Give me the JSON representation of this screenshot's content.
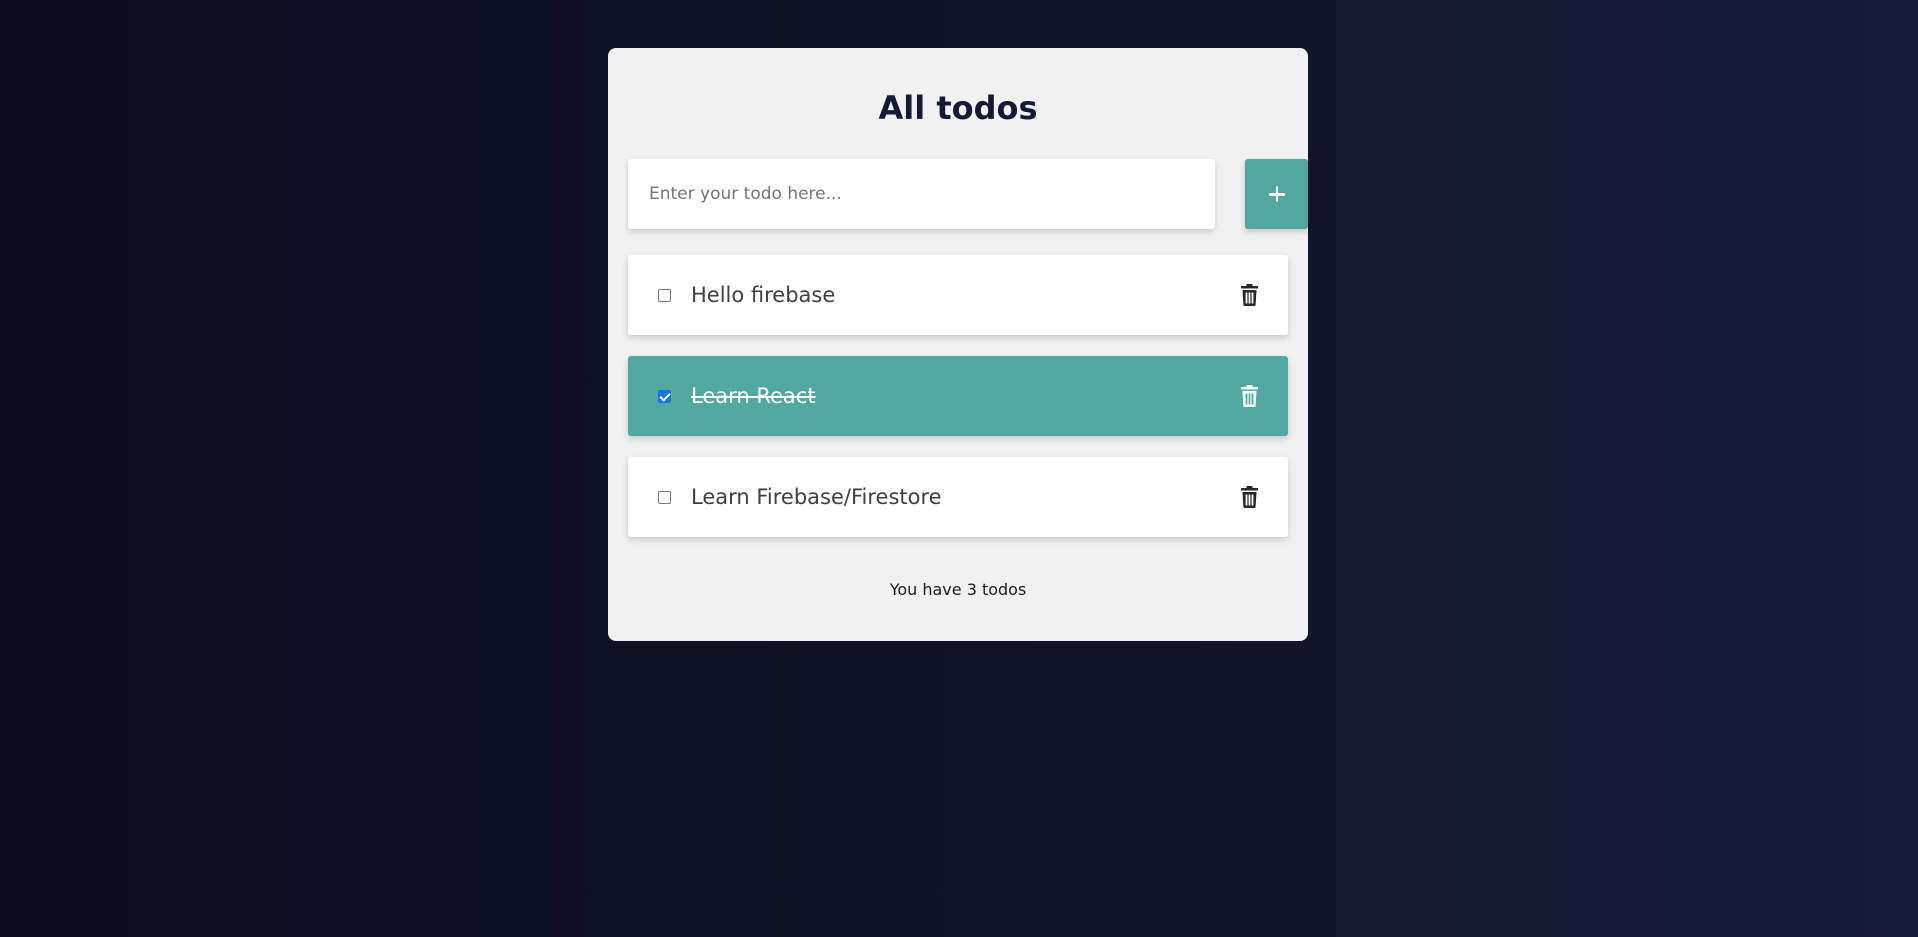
{
  "app": {
    "title": "All todos"
  },
  "input": {
    "placeholder": "Enter your todo here...",
    "value": ""
  },
  "add_button": {
    "icon": "plus-icon"
  },
  "todos": [
    {
      "text": "Hello firebase",
      "completed": false
    },
    {
      "text": "Learn React",
      "completed": true
    },
    {
      "text": "Learn Firebase/Firestore",
      "completed": false
    }
  ],
  "footer": {
    "count_text": "You have 3 todos"
  },
  "colors": {
    "accent": "#52a8a1",
    "card_background": "#f1f1f1",
    "title": "#141a33",
    "checkbox_checked": "#1a73e8"
  }
}
